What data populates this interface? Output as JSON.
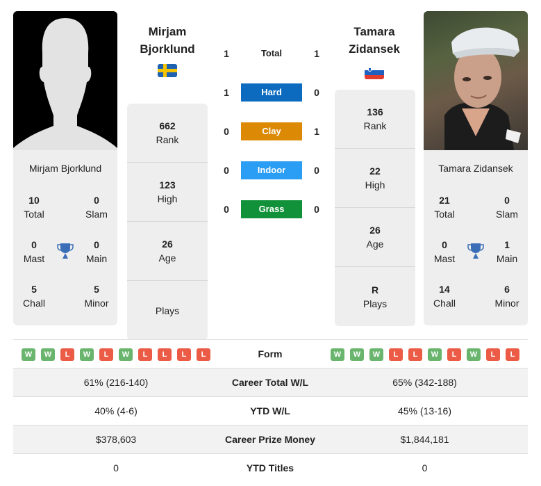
{
  "colors": {
    "hard": "#0c6bbf",
    "clay": "#dc8a06",
    "indoor": "#2a9df4",
    "grass": "#11923a",
    "win": "#6ab56e",
    "loss": "#ec5b45",
    "trophy": "#3a6fb8"
  },
  "player1": {
    "name_line1": "Mirjam",
    "name_line2": "Bjorklund",
    "card_name": "Mirjam Bjorklund",
    "flag": "sweden-flag",
    "titles": {
      "total": {
        "value": "10",
        "label": "Total"
      },
      "slam": {
        "value": "0",
        "label": "Slam"
      },
      "mast": {
        "value": "0",
        "label": "Mast"
      },
      "main": {
        "value": "0",
        "label": "Main"
      },
      "chall": {
        "value": "5",
        "label": "Chall"
      },
      "minor": {
        "value": "5",
        "label": "Minor"
      }
    },
    "stats": [
      {
        "value": "662",
        "label": "Rank"
      },
      {
        "value": "123",
        "label": "High"
      },
      {
        "value": "26",
        "label": "Age"
      },
      {
        "value": "",
        "label": "Plays"
      }
    ],
    "form": [
      "W",
      "W",
      "L",
      "W",
      "L",
      "W",
      "L",
      "L",
      "L",
      "L"
    ]
  },
  "player2": {
    "name_line1": "Tamara",
    "name_line2": "Zidansek",
    "card_name": "Tamara Zidansek",
    "flag": "slovenia-flag",
    "titles": {
      "total": {
        "value": "21",
        "label": "Total"
      },
      "slam": {
        "value": "0",
        "label": "Slam"
      },
      "mast": {
        "value": "0",
        "label": "Mast"
      },
      "main": {
        "value": "1",
        "label": "Main"
      },
      "chall": {
        "value": "14",
        "label": "Chall"
      },
      "minor": {
        "value": "6",
        "label": "Minor"
      }
    },
    "stats": [
      {
        "value": "136",
        "label": "Rank"
      },
      {
        "value": "22",
        "label": "High"
      },
      {
        "value": "26",
        "label": "Age"
      },
      {
        "value": "R",
        "label": "Plays"
      }
    ],
    "form": [
      "W",
      "W",
      "W",
      "L",
      "L",
      "W",
      "L",
      "W",
      "L",
      "L"
    ]
  },
  "h2h": [
    {
      "label": "Total",
      "left": "1",
      "right": "1"
    },
    {
      "label": "Hard",
      "left": "1",
      "right": "0"
    },
    {
      "label": "Clay",
      "left": "0",
      "right": "1"
    },
    {
      "label": "Indoor",
      "left": "0",
      "right": "0"
    },
    {
      "label": "Grass",
      "left": "0",
      "right": "0"
    }
  ],
  "table": {
    "form_label": "Form",
    "rows": [
      {
        "label": "Career Total W/L",
        "left": "61% (216-140)",
        "right": "65% (342-188)"
      },
      {
        "label": "YTD W/L",
        "left": "40% (4-6)",
        "right": "45% (13-16)"
      },
      {
        "label": "Career Prize Money",
        "left": "$378,603",
        "right": "$1,844,181"
      },
      {
        "label": "YTD Titles",
        "left": "0",
        "right": "0"
      }
    ]
  }
}
